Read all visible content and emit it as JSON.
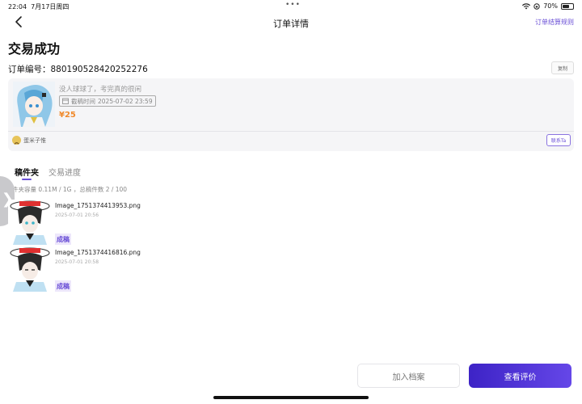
{
  "status_bar": {
    "time": "22:04",
    "date": "7月17日周四",
    "dots": "•••",
    "battery": "70%",
    "battery_level": 0.7
  },
  "nav": {
    "back_icon": "chevron-left-icon",
    "title": "订单详情",
    "settlement_rules": "订单结算规则"
  },
  "order": {
    "status": "交易成功",
    "number_label": "订单编号：",
    "number": "880190528420252276",
    "copy_label": "复制"
  },
  "product": {
    "title": "没人球球了，考完真的很闲",
    "deadline_label": "截稿时间",
    "deadline": "2025-07-02 23:59",
    "price": "¥25",
    "seller_name": "蛋米子惟",
    "contact_label": "联系Ta"
  },
  "tabs": [
    {
      "label": "稿件夹"
    },
    {
      "label": "交易进度"
    }
  ],
  "capacity_text": "件夹容量 0.11M / 1G ，总稿件数 2 / 100",
  "files": [
    {
      "name": "Image_1751374413953.png",
      "date": "2025-07-01 20:56",
      "tag": "成稿"
    },
    {
      "name": "Image_1751374416816.png",
      "date": "2025-07-01 20:58",
      "tag": "成稿"
    }
  ],
  "side_handle_glyph": "❯",
  "actions": {
    "archive": "加入档案",
    "review": "查看评价"
  },
  "colors": {
    "accent": "#6a4fd6",
    "price": "#f08a2c",
    "primary_button": "#4a2fd4"
  }
}
